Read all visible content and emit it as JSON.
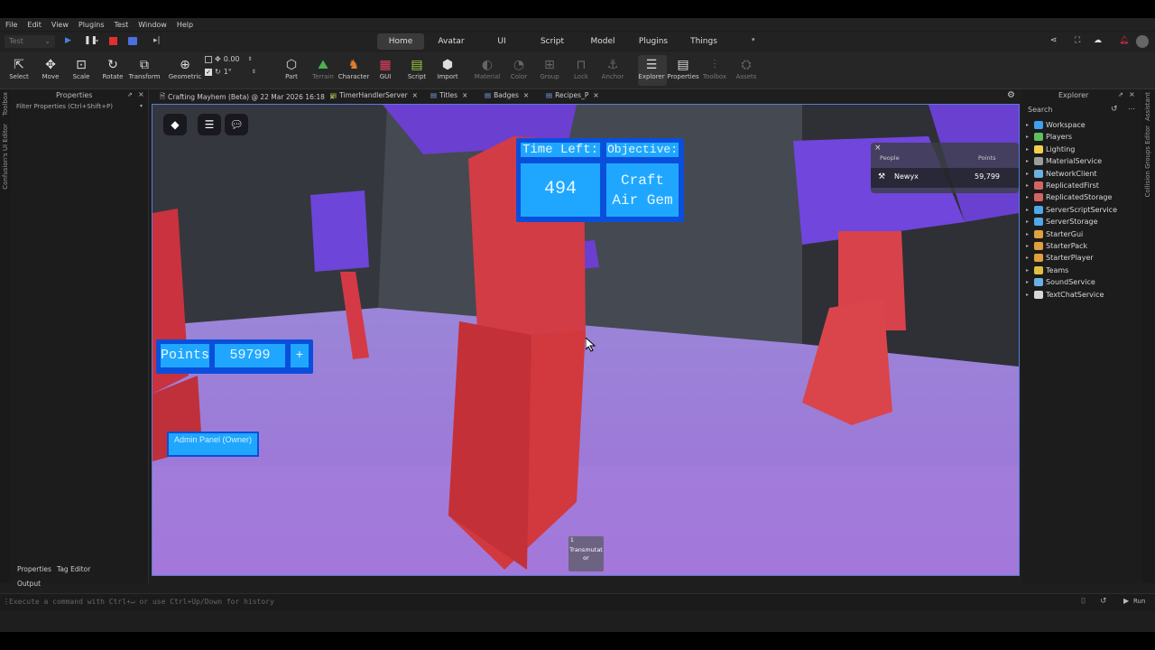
{
  "menu": [
    "File",
    "Edit",
    "View",
    "Plugins",
    "Test",
    "Window",
    "Help"
  ],
  "test_mode": "Test",
  "tabs": [
    "Home",
    "Avatar",
    "UI",
    "Script",
    "Model",
    "Plugins",
    "Things"
  ],
  "ribbon": {
    "tools": [
      "Select",
      "Move",
      "Scale",
      "Rotate",
      "Transform"
    ],
    "geometric": "Geometric",
    "snap_value": "0.00",
    "snap_angle": "1°",
    "insert": [
      "Part",
      "Terrain",
      "Character",
      "GUI",
      "Script",
      "Import"
    ],
    "edit": [
      "Material",
      "Color",
      "Group",
      "Lock",
      "Anchor"
    ],
    "panels": [
      "Explorer",
      "Properties",
      "Toolbox",
      "Assets"
    ]
  },
  "left_strip": [
    "Toolbox",
    "Confusion's UI Editor"
  ],
  "properties": {
    "title": "Properties",
    "filter": "Filter Properties (Ctrl+Shift+P)",
    "tabs": [
      "Properties",
      "Tag Editor"
    ]
  },
  "doc_tabs": [
    "Crafting Mayhem (Beta) @ 22 Mar 2026 16:18",
    "TimerHandlerServer",
    "Titles",
    "Badges",
    "Recipes_P"
  ],
  "game": {
    "time_label": "Time Left:",
    "time_value": "494",
    "objective_label": "Objective:",
    "objective_value": "Craft Air Gem",
    "points_label": "Points",
    "points_value": "59799",
    "points_plus": "+",
    "admin_button": "Admin Panel (Owner)",
    "hotbar_number": "1",
    "hotbar_item": "Transmutator",
    "leaderboard": {
      "col_people": "People",
      "col_points": "Points",
      "player_name": "Newyx",
      "player_points": "59,799"
    }
  },
  "explorer": {
    "title": "Explorer",
    "search_placeholder": "Search",
    "items": [
      {
        "name": "Workspace",
        "color": "#3ea0f0"
      },
      {
        "name": "Players",
        "color": "#5fbf5f"
      },
      {
        "name": "Lighting",
        "color": "#f2d04a"
      },
      {
        "name": "MaterialService",
        "color": "#9d9d9d"
      },
      {
        "name": "NetworkClient",
        "color": "#6ab0e0"
      },
      {
        "name": "ReplicatedFirst",
        "color": "#d46464"
      },
      {
        "name": "ReplicatedStorage",
        "color": "#d46464"
      },
      {
        "name": "ServerScriptService",
        "color": "#4fa8e8"
      },
      {
        "name": "ServerStorage",
        "color": "#4fa8e8"
      },
      {
        "name": "StarterGui",
        "color": "#e0a040"
      },
      {
        "name": "StarterPack",
        "color": "#e0a040"
      },
      {
        "name": "StarterPlayer",
        "color": "#e0a040"
      },
      {
        "name": "Teams",
        "color": "#e0c040"
      },
      {
        "name": "SoundService",
        "color": "#6ab0e0"
      },
      {
        "name": "TextChatService",
        "color": "#d8d8d8"
      }
    ]
  },
  "right_strip": [
    "Assistant",
    "Collision Groups Editor"
  ],
  "output": {
    "label": "Output",
    "command_placeholder": "Execute a command with Ctrl+↵ or use Ctrl+Up/Down for history",
    "run": "Run"
  }
}
